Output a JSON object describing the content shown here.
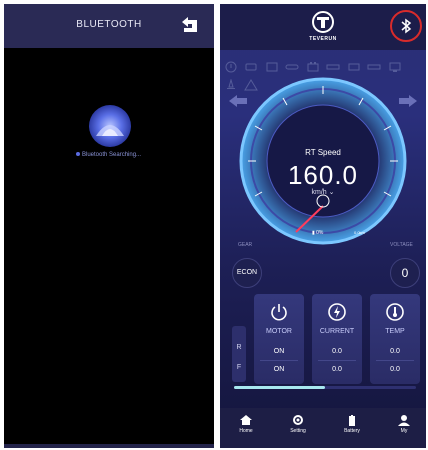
{
  "left_screen": {
    "title": "BLUETOOTH",
    "search_text": "Bluetooth Searching..."
  },
  "right_screen": {
    "brand": "TEVERUN",
    "speed": {
      "label": "RT Speed",
      "value": "160.0",
      "unit": "km/h"
    },
    "battery_text": "0%",
    "range_text": "0.0km",
    "gear": {
      "label": "GEAR",
      "value": "ECON"
    },
    "voltage": {
      "label": "VOLTAGE",
      "value": "0"
    },
    "rf_labels": [
      "R",
      "F"
    ],
    "cards": [
      {
        "label": "MOTOR",
        "values": [
          "ON",
          "ON"
        ],
        "icon": "power-icon"
      },
      {
        "label": "CURRENT",
        "values": [
          "0.0",
          "0.0"
        ],
        "icon": "current-icon"
      },
      {
        "label": "TEMP",
        "values": [
          "0.0",
          "0.0"
        ],
        "icon": "thermometer-icon"
      }
    ],
    "progress_fraction": 0.5,
    "nav": [
      {
        "label": "Home",
        "icon": "home-icon"
      },
      {
        "label": "Setting",
        "icon": "gear-icon"
      },
      {
        "label": "Battery",
        "icon": "battery-icon"
      },
      {
        "label": "My",
        "icon": "user-icon"
      }
    ],
    "colors": {
      "accent": "#2a2f7c",
      "highlight_ring": "#d92b2b",
      "progress": "#a8e8ef"
    }
  }
}
